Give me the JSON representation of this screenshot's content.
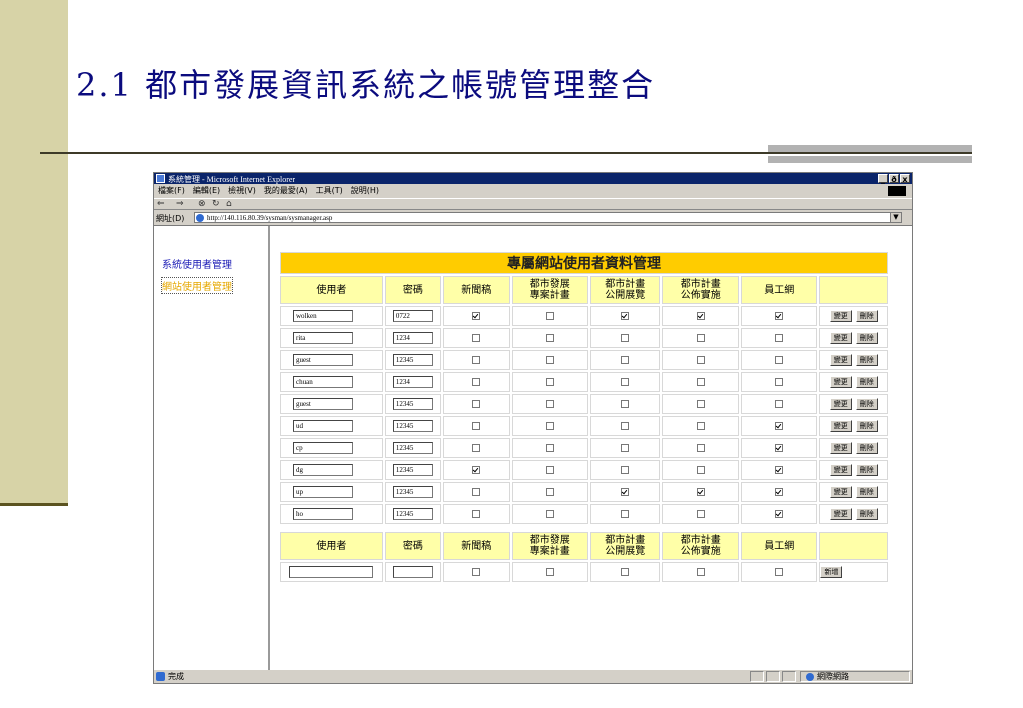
{
  "slide": {
    "title": "2.1 都市發展資訊系統之帳號管理整合"
  },
  "browser": {
    "window_title": "系統管理 - Microsoft Internet Explorer",
    "window_buttons": [
      "_",
      "ð",
      "x"
    ],
    "menu": [
      "檔案(F)",
      "編輯(E)",
      "檢視(V)",
      "我的最愛(A)",
      "工具(T)",
      "說明(H)"
    ],
    "toolbar_icons": [
      "back-icon",
      "forward-icon",
      "stop-icon",
      "refresh-icon",
      "home-icon"
    ],
    "address_label": "網址(D)",
    "address_url": "http://140.116.80.39/sysman/sysmanager.asp",
    "status_text": "完成",
    "zone_text": "網際網路"
  },
  "nav": {
    "items": [
      "系統使用者管理",
      "網站使用者管理"
    ],
    "active_index": 1
  },
  "main": {
    "banner": "專屬網站使用者資料管理",
    "columns": [
      "使用者",
      "密碼",
      "新聞稿",
      "都市發展\n專案計畫",
      "都市計畫\n公開展覽",
      "都市計畫\n公佈實施",
      "員工網"
    ],
    "edit_label": "變更",
    "delete_label": "刪除",
    "rows": [
      {
        "user": "wolken",
        "password": "0722",
        "checks": [
          true,
          false,
          true,
          true,
          true
        ]
      },
      {
        "user": "rita",
        "password": "1234",
        "checks": [
          false,
          false,
          false,
          false,
          false
        ]
      },
      {
        "user": "guest",
        "password": "12345",
        "checks": [
          false,
          false,
          false,
          false,
          false
        ]
      },
      {
        "user": "chuan",
        "password": "1234",
        "checks": [
          false,
          false,
          false,
          false,
          false
        ]
      },
      {
        "user": "guest",
        "password": "12345",
        "checks": [
          false,
          false,
          false,
          false,
          false
        ]
      },
      {
        "user": "ud",
        "password": "12345",
        "checks": [
          false,
          false,
          false,
          false,
          true
        ]
      },
      {
        "user": "cp",
        "password": "12345",
        "checks": [
          false,
          false,
          false,
          false,
          true
        ]
      },
      {
        "user": "dg",
        "password": "12345",
        "checks": [
          true,
          false,
          false,
          false,
          true
        ]
      },
      {
        "user": "up",
        "password": "12345",
        "checks": [
          false,
          false,
          true,
          true,
          true
        ]
      },
      {
        "user": "ho",
        "password": "12345",
        "checks": [
          false,
          false,
          false,
          false,
          true
        ]
      }
    ]
  },
  "add_form": {
    "columns": [
      "使用者",
      "密碼",
      "新聞稿",
      "都市發展\n專案計畫",
      "都市計畫\n公開展覽",
      "都市計畫\n公佈實施",
      "員工網"
    ],
    "add_label": "新增",
    "user_value": "",
    "password_value": ""
  }
}
